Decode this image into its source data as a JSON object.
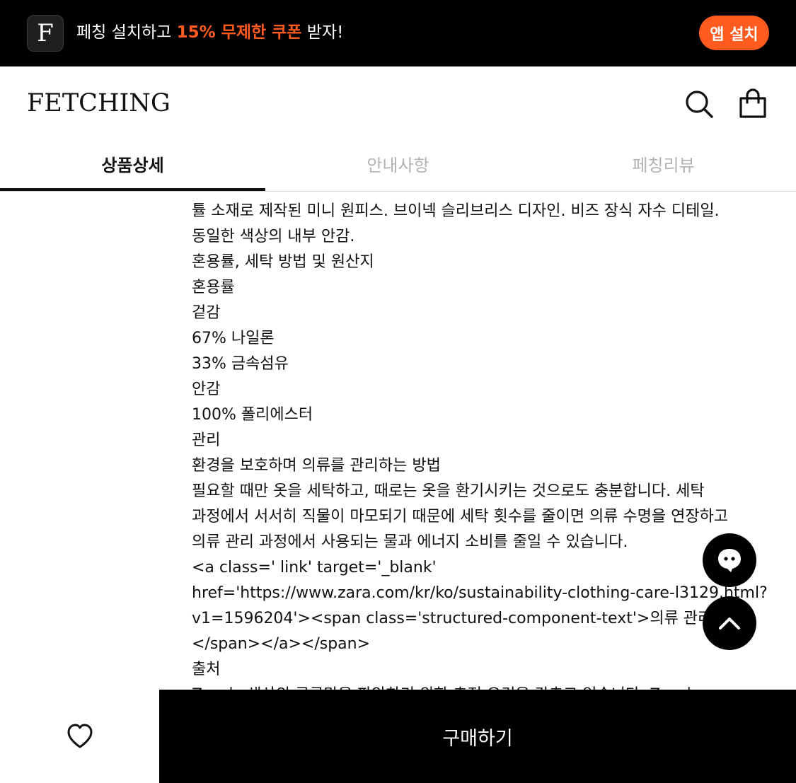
{
  "promo": {
    "text_before": "페칭 설치하고 ",
    "highlight": "15% 무제한 쿠폰",
    "text_after": " 받자!",
    "app_letter": "F",
    "install_label": "앱 설치",
    "accent_color": "#ff5a1f"
  },
  "header": {
    "logo": "FETCHING",
    "icons": [
      "search-icon",
      "shopping-bag-icon"
    ]
  },
  "tabs": [
    {
      "label": "상품상세",
      "active": true
    },
    {
      "label": "안내사항",
      "active": false
    },
    {
      "label": "페칭리뷰",
      "active": false
    }
  ],
  "content": {
    "lines": [
      "튤 소재로 제작된 미니 원피스. 브이넥 슬리브리스 디자인. 비즈 장식 자수 디테일.",
      "동일한 색상의 내부 안감.",
      "혼용률, 세탁 방법 및 원산지",
      "혼용률",
      "겉감",
      "67% 나일론",
      "33% 금속섬유",
      "안감",
      "100% 폴리에스터",
      "관리",
      "환경을 보호하며 의류를 관리하는 방법",
      "필요할 때만 옷을 세탁하고, 때로는 옷을 환기시키는 것으로도 충분합니다. 세탁",
      "과정에서 서서히 직물이 마모되기 때문에 세탁 횟수를 줄이면 의류 수명을 연장하고",
      "의류 관리 과정에서 사용되는 물과 에너지 소비를 줄일 수 있습니다.",
      "<a class=' link' target='_blank'",
      "href='https://www.zara.com/kr/ko/sustainability-clothing-care-l3129.html?",
      "v1=1596204'><span class='structured-component-text'>의류 관리",
      "</span></a></span>",
      "출처",
      "Zara는 생산의 공급망을 파악하기 위한 추적 요건을 갖추고 있습니다. Zara는"
    ]
  },
  "floating": {
    "chat_icon": "chat-icon",
    "top_icon": "chevron-up-icon"
  },
  "bottom_bar": {
    "wishlist_icon": "heart-icon",
    "buy_label": "구매하기"
  }
}
